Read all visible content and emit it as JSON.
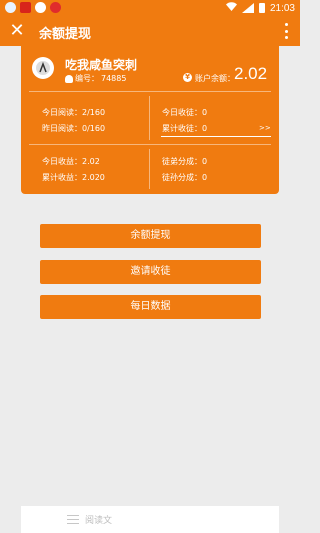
{
  "status_bar": {
    "time": "21:03",
    "icons": [
      "qq-icon",
      "toutiao-icon",
      "wechat-icon",
      "weibo-icon"
    ],
    "right_icons": [
      "wifi-icon",
      "signal-icon",
      "battery-icon"
    ]
  },
  "app_bar": {
    "title": "余额提现",
    "left_icon": "close-icon",
    "right_icon": "more-vertical-icon"
  },
  "profile": {
    "name": "吃我咸鱼突刺",
    "id_label": "编号：",
    "id_value": "74885",
    "balance_label": "账户余额：",
    "balance_value": "2.02"
  },
  "stats": {
    "today_read": "今日阅读：2/160",
    "yesterday_read": "昨日阅读：0/160",
    "today_disciples": "今日收徒：0",
    "total_disciples": "累计收徒：0",
    "today_income": "今日收益：2.02",
    "total_income": "累计收益：2.020",
    "disciple_share": "徒弟分成：0",
    "grand_disciple_share": "徒孙分成：0",
    "more_arrow": ">>"
  },
  "buttons": {
    "withdraw": "余额提现",
    "invite": "邀请收徒",
    "daily": "每日数据"
  },
  "tab_bar": {
    "label": "阅读文",
    "icon": "list-icon"
  },
  "colors": {
    "accent": "#f07b10",
    "background": "#ececec"
  }
}
